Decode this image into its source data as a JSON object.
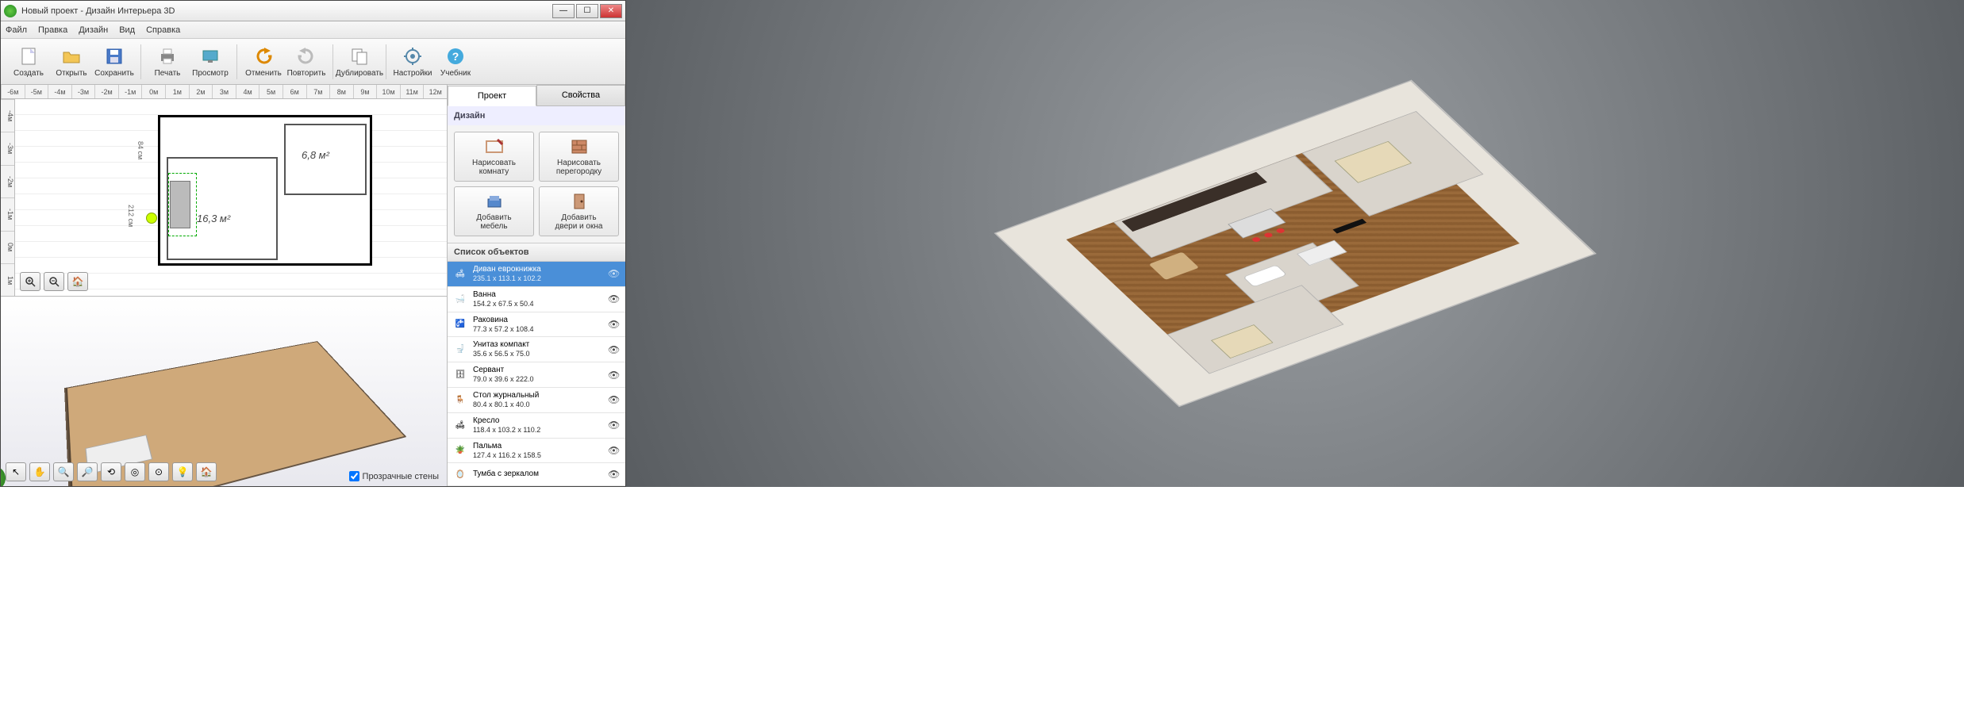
{
  "window": {
    "title": "Новый проект - Дизайн Интерьера 3D"
  },
  "menu": [
    "Файл",
    "Правка",
    "Дизайн",
    "Вид",
    "Справка"
  ],
  "toolbar": [
    {
      "id": "create",
      "label": "Создать"
    },
    {
      "id": "open",
      "label": "Открыть"
    },
    {
      "id": "save",
      "label": "Сохранить"
    },
    {
      "id": "sep"
    },
    {
      "id": "print",
      "label": "Печать"
    },
    {
      "id": "view",
      "label": "Просмотр"
    },
    {
      "id": "sep"
    },
    {
      "id": "undo",
      "label": "Отменить"
    },
    {
      "id": "redo",
      "label": "Повторить"
    },
    {
      "id": "sep"
    },
    {
      "id": "duplicate",
      "label": "Дублировать"
    },
    {
      "id": "sep"
    },
    {
      "id": "settings",
      "label": "Настройки"
    },
    {
      "id": "tutorial",
      "label": "Учебник"
    }
  ],
  "ruler_h": [
    "-6м",
    "-5м",
    "-4м",
    "-3м",
    "-2м",
    "-1м",
    "0м",
    "1м",
    "2м",
    "3м",
    "4м",
    "5м",
    "6м",
    "7м",
    "8м",
    "9м",
    "10м",
    "11м",
    "12м"
  ],
  "ruler_v": [
    "-4м",
    "-3м",
    "-2м",
    "-1м",
    "0м",
    "1м"
  ],
  "plan": {
    "room_a_area": "16,3 м²",
    "room_b_area": "6,8 м²",
    "dim_h": "84 см",
    "dim_v": "212 см"
  },
  "sidepanel": {
    "tabs": {
      "project": "Проект",
      "properties": "Свойства"
    },
    "design_title": "Дизайн",
    "buttons": [
      {
        "id": "draw-room",
        "line1": "Нарисовать",
        "line2": "комнату"
      },
      {
        "id": "draw-partition",
        "line1": "Нарисовать",
        "line2": "перегородку"
      },
      {
        "id": "add-furniture",
        "line1": "Добавить",
        "line2": "мебель"
      },
      {
        "id": "add-doors",
        "line1": "Добавить",
        "line2": "двери и окна"
      }
    ],
    "objects_title": "Список объектов",
    "objects": [
      {
        "name": "Диван еврокнижка",
        "dim": "235.1 x 113.1 x 102.2",
        "active": true
      },
      {
        "name": "Ванна",
        "dim": "154.2 x 67.5 x 50.4"
      },
      {
        "name": "Раковина",
        "dim": "77.3 x 57.2 x 108.4"
      },
      {
        "name": "Унитаз компакт",
        "dim": "35.6 x 56.5 x 75.0"
      },
      {
        "name": "Сервант",
        "dim": "79.0 x 39.6 x 222.0"
      },
      {
        "name": "Стол журнальный",
        "dim": "80.4 x 80.1 x 40.0"
      },
      {
        "name": "Кресло",
        "dim": "118.4 x 103.2 x 110.2"
      },
      {
        "name": "Пальма",
        "dim": "127.4 x 116.2 x 158.5"
      },
      {
        "name": "Тумба с зеркалом",
        "dim": ""
      }
    ]
  },
  "transparent_walls": "Прозрачные стены"
}
